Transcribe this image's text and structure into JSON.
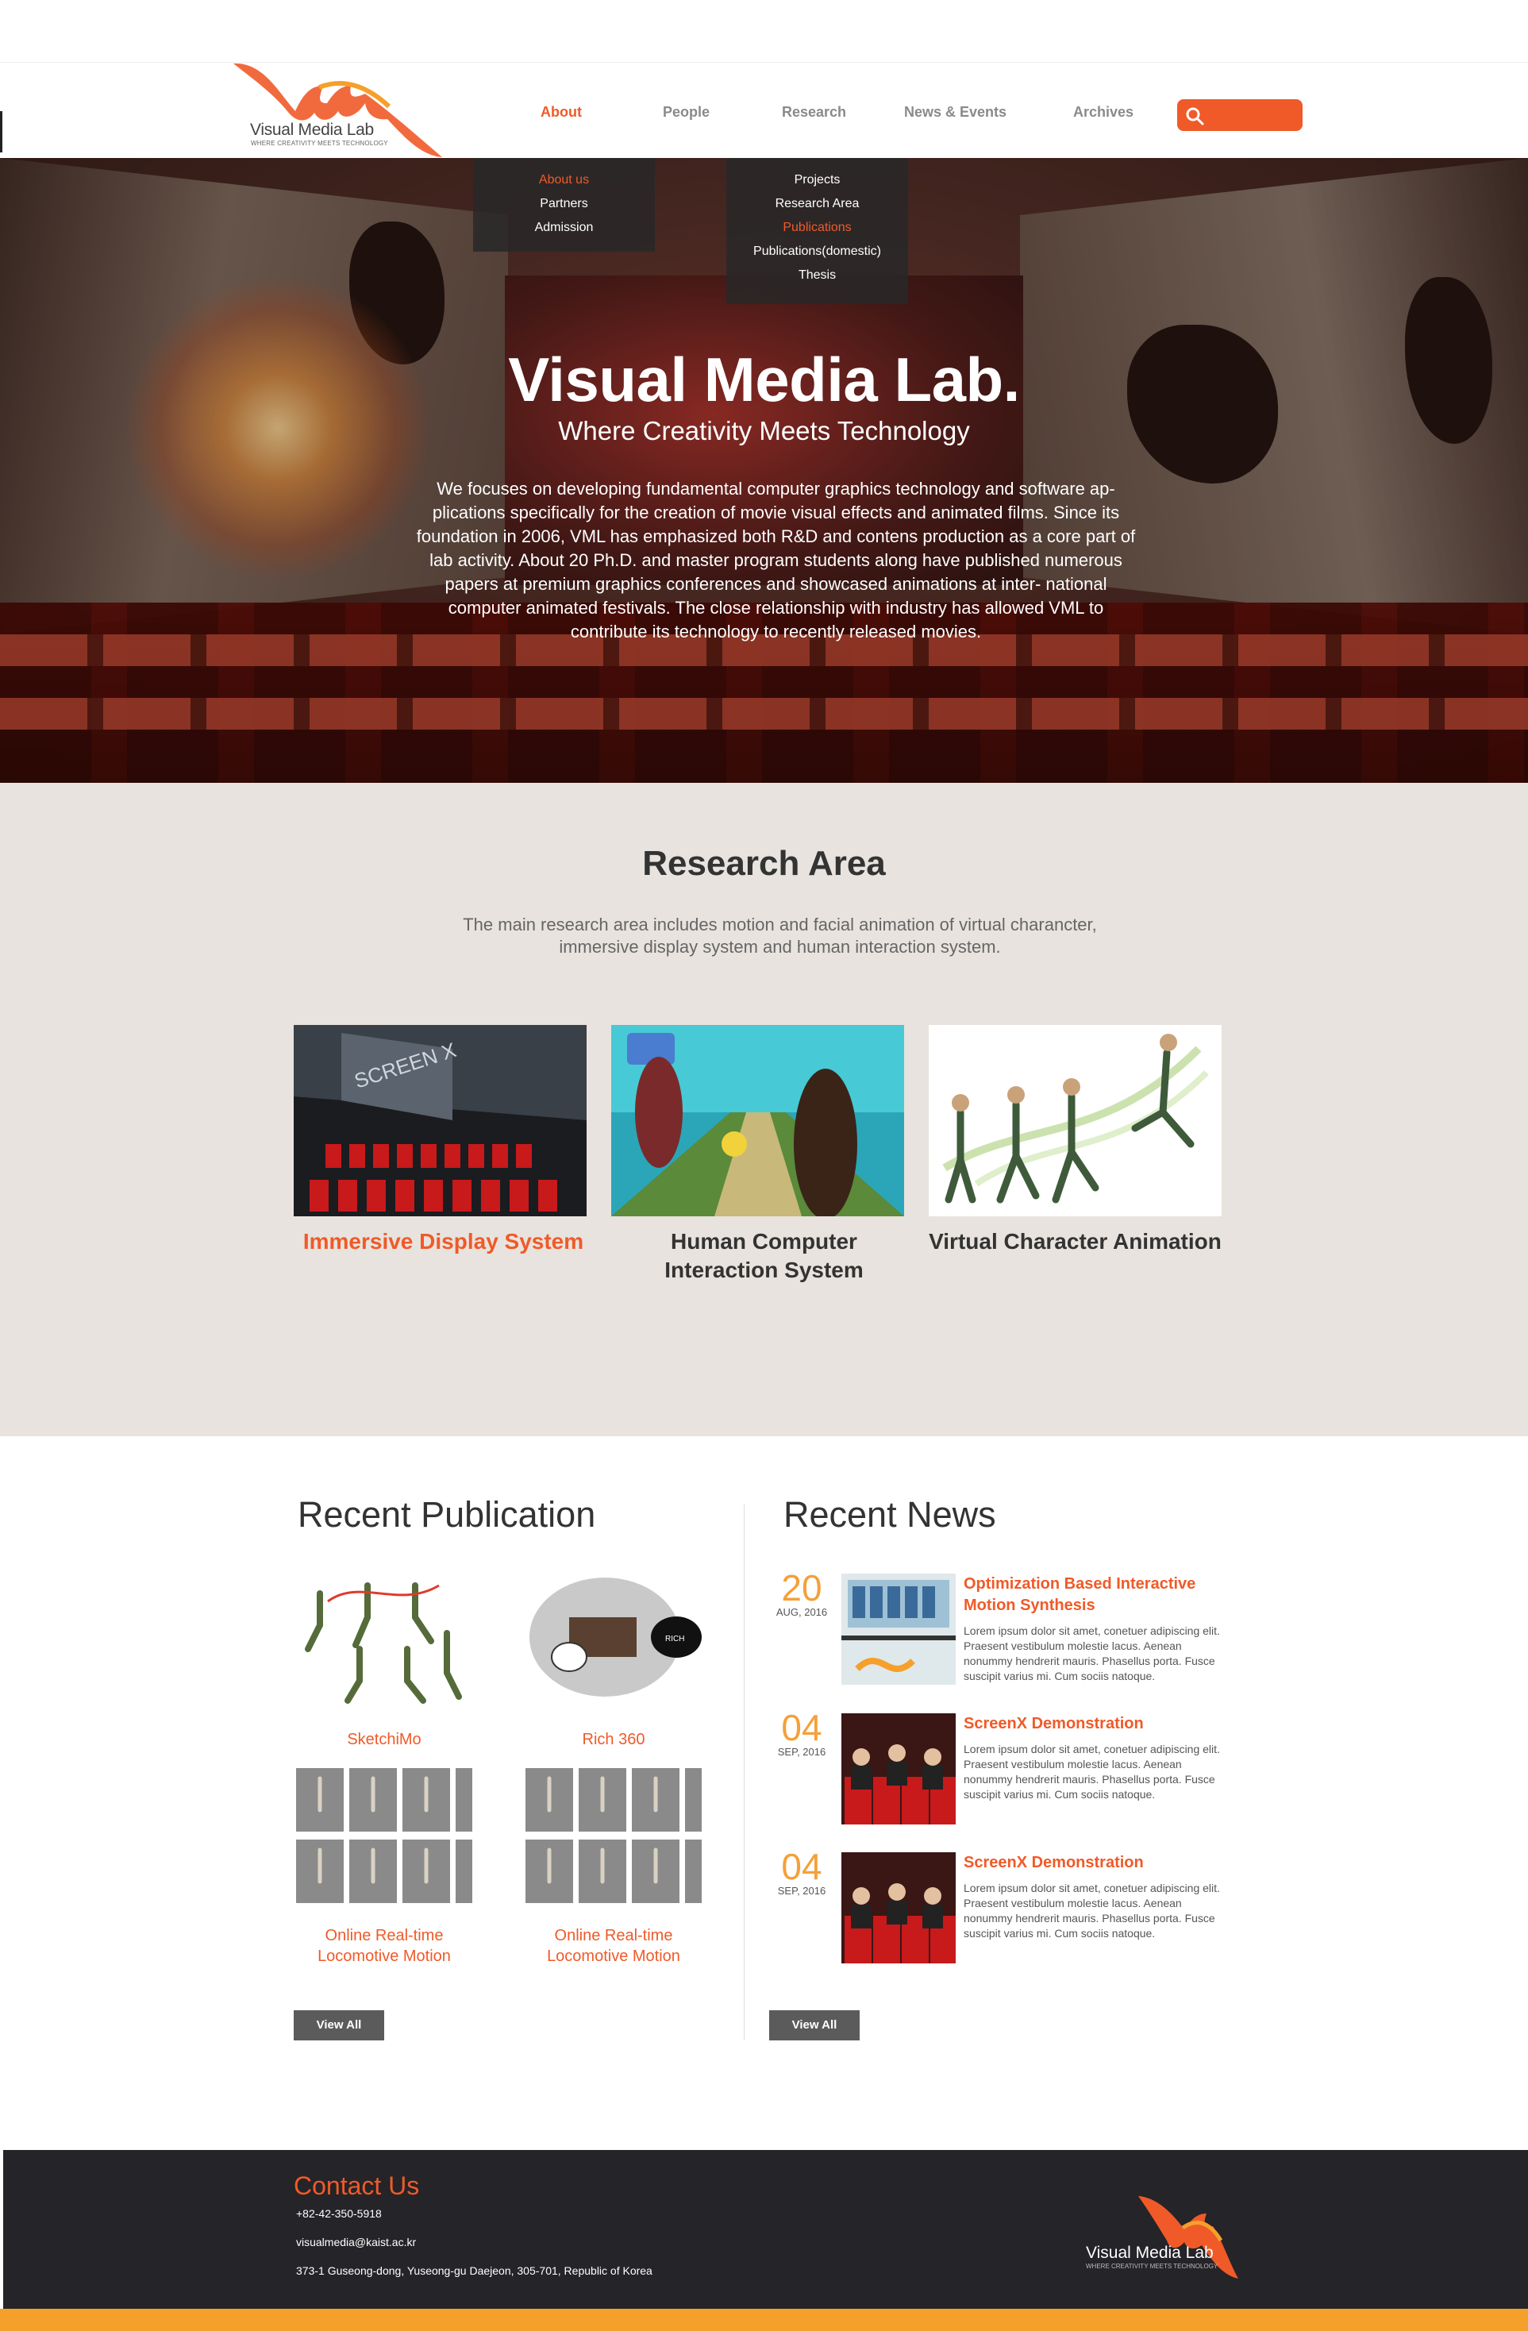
{
  "header": {
    "logo_text": "Visual Media Lab",
    "logo_tagline": "WHERE CREATIVITY MEETS TECHNOLOGY",
    "nav": [
      {
        "label": "About",
        "active": true
      },
      {
        "label": "People",
        "active": false
      },
      {
        "label": "Research",
        "active": false
      },
      {
        "label": "News & Events",
        "active": false
      },
      {
        "label": "Archives",
        "active": false
      }
    ],
    "about_menu": [
      {
        "label": "About us",
        "active": true
      },
      {
        "label": "Partners",
        "active": false
      },
      {
        "label": "Admission",
        "active": false
      }
    ],
    "research_menu": [
      {
        "label": "Projects",
        "active": false
      },
      {
        "label": "Research Area",
        "active": false
      },
      {
        "label": "Publications",
        "active": true
      },
      {
        "label": "Publications(domestic)",
        "active": false
      },
      {
        "label": "Thesis",
        "active": false
      }
    ],
    "search_icon": "search-icon"
  },
  "hero": {
    "title": "Visual Media Lab.",
    "subtitle": "Where Creativity Meets Technology",
    "description": "We focuses on developing fundamental computer graphics technology and software ap- plications specifically for the creation of movie visual effects and animated films. Since its foundation in 2006, VML has emphasized both R&D and contens production as a core part of lab activity. About 20 Ph.D. and master program students along have published numerous papers at premium graphics conferences and showcased animations at inter- national computer animated festivals. The close relationship with industry has allowed VML to contribute its technology to recently released movies."
  },
  "research_area": {
    "title": "Research Area",
    "description": "The main research area includes motion and facial animation of virtual charancter, immersive display system and human interaction system.",
    "items": [
      {
        "label": "Immersive Display System",
        "active": true
      },
      {
        "label": "Human Computer Interaction System",
        "active": false
      },
      {
        "label": "Virtual Character Animation",
        "active": false
      }
    ]
  },
  "publications": {
    "title": "Recent Publication",
    "items": [
      {
        "label": "SketchiMo"
      },
      {
        "label": "Rich 360"
      },
      {
        "label": "Online Real-time Locomotive Motion"
      },
      {
        "label": "Online Real-time Locomotive Motion"
      }
    ],
    "view_all": "View All"
  },
  "news": {
    "title": "Recent News",
    "items": [
      {
        "day": "20",
        "month": "AUG, 2016",
        "title": "Optimization Based Interactive Motion Synthesis",
        "body": "Lorem ipsum dolor sit amet, conetuer adipiscing elit. Praesent vestibulum molestie lacus. Aenean nonummy hendrerit mauris. Phasellus porta. Fusce suscipit varius mi. Cum sociis natoque."
      },
      {
        "day": "04",
        "month": "SEP, 2016",
        "title": "ScreenX Demonstration",
        "body": "Lorem ipsum dolor sit amet, conetuer adipiscing elit. Praesent vestibulum molestie lacus. Aenean nonummy hendrerit mauris. Phasellus porta. Fusce suscipit varius mi. Cum sociis natoque."
      },
      {
        "day": "04",
        "month": "SEP, 2016",
        "title": "ScreenX Demonstration",
        "body": "Lorem ipsum dolor sit amet, conetuer adipiscing elit. Praesent vestibulum molestie lacus. Aenean nonummy hendrerit mauris. Phasellus porta. Fusce suscipit varius mi. Cum sociis natoque."
      }
    ],
    "view_all": "View All"
  },
  "footer": {
    "contact_title": "Contact Us",
    "phone": "+82-42-350-5918",
    "email": "visualmedia@kaist.ac.kr",
    "address": "373-1 Guseong-dong, Yuseong-gu Daejeon, 305-701, Republic of Korea",
    "logo_text": "Visual Media Lab",
    "logo_tagline": "WHERE CREATIVITY MEETS TECHNOLOGY"
  },
  "colors": {
    "accent": "#f05a28",
    "accent_yellow": "#f5a02a",
    "footer_bg": "#252428",
    "research_bg": "#e8e3de"
  }
}
